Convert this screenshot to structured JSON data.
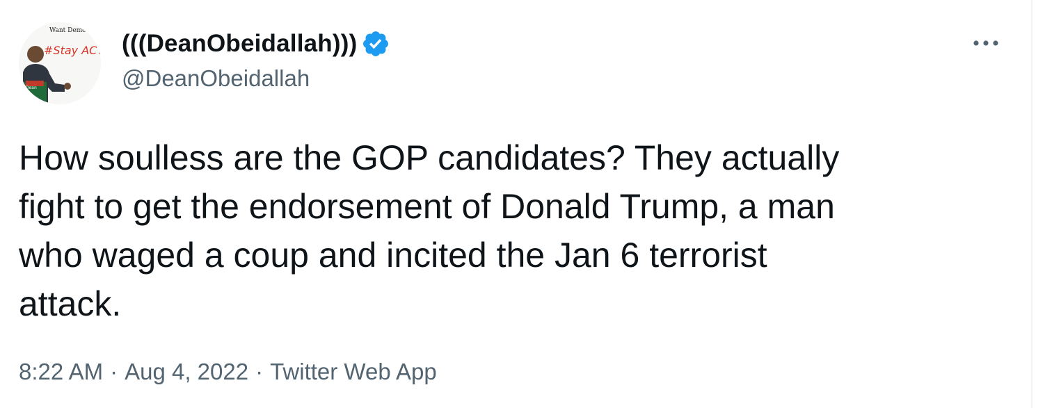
{
  "author": {
    "display_name": "(((DeanObeidallah)))",
    "handle": "@DeanObeidallah",
    "verified": true,
    "avatar": {
      "icon": "profile-avatar",
      "text_top": "Want Democracy?",
      "text_main": "#Stay ACTIVE!",
      "text_badge": "Dean"
    }
  },
  "tweet": {
    "text": "How soulless are the GOP candidates?   They actually\nfight to get the endorsement of Donald Trump, a man\nwho waged a coup and incited the Jan 6 terrorist\nattack."
  },
  "meta": {
    "time": "8:22 AM",
    "separator": "·",
    "date": "Aug 4, 2022",
    "source": "Twitter Web App"
  },
  "actions": {
    "more_icon": "more-horizontal-icon"
  },
  "colors": {
    "text_primary": "#0f1419",
    "text_secondary": "#536471",
    "verified_blue": "#1d9bf0",
    "divider": "#eff3f4"
  }
}
